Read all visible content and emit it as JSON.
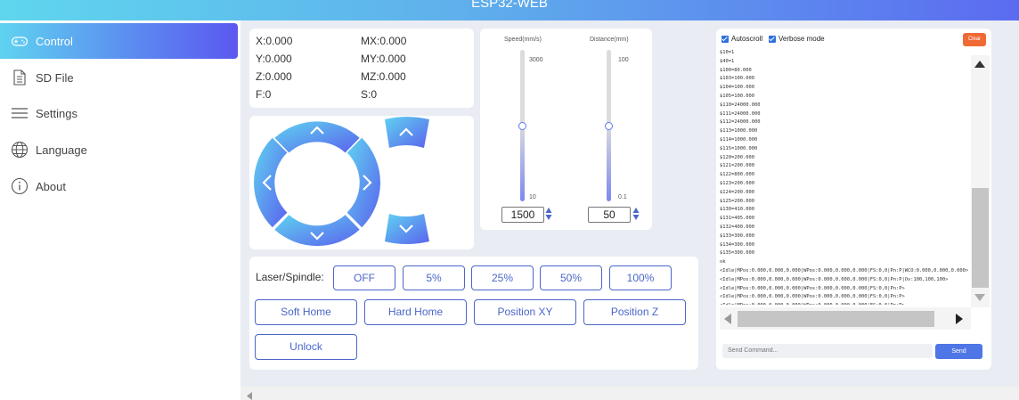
{
  "app": {
    "title": "ESP32-WEB"
  },
  "sidebar": {
    "items": [
      {
        "label": "Control",
        "icon": "gamepad-icon",
        "active": true
      },
      {
        "label": "SD File",
        "icon": "file-icon"
      },
      {
        "label": "Settings",
        "icon": "menu-icon"
      },
      {
        "label": "Language",
        "icon": "globe-icon"
      },
      {
        "label": "About",
        "icon": "info-icon"
      }
    ]
  },
  "coords": {
    "x": "X:0.000",
    "mx": "MX:0.000",
    "y": "Y:0.000",
    "my": "MY:0.000",
    "z": "Z:0.000",
    "mz": "MZ:0.000",
    "f": "F:0",
    "s": "S:0"
  },
  "sliders": {
    "speed": {
      "label": "Speed(mm/s)",
      "max_label": "3000",
      "min_label": "10",
      "value": "1500"
    },
    "distance": {
      "label": "Distance(mm)",
      "max_label": "100",
      "min_label": "0.1",
      "value": "50"
    }
  },
  "laser": {
    "label": "Laser/Spindle:",
    "buttons": [
      "OFF",
      "5%",
      "25%",
      "50%",
      "100%"
    ]
  },
  "actions": {
    "soft_home": "Soft Home",
    "hard_home": "Hard Home",
    "position_xy": "Position XY",
    "position_z": "Position Z",
    "unlock": "Unlock"
  },
  "console": {
    "autoscroll": "Autoscroll",
    "verbose": "Verbose mode",
    "clear": "Clear",
    "placeholder": "Send Command...",
    "send": "Send",
    "lines": [
      "$10=1",
      "$40=1",
      "$100=80.000",
      "$103=100.000",
      "$104=100.000",
      "$105=100.000",
      "$110=24000.000",
      "$111=24000.000",
      "$112=24000.000",
      "$113=1000.000",
      "$114=1000.000",
      "$115=1000.000",
      "$120=200.000",
      "$121=200.000",
      "$122=800.000",
      "$123=200.000",
      "$124=200.000",
      "$125=200.000",
      "$130=410.000",
      "$131=405.000",
      "$132=400.000",
      "$133=300.000",
      "$134=300.000",
      "$135=300.000",
      "ok",
      "<Idle|MPos:0.000,0.000,0.000|WPos:0.000,0.000,0.000|FS:0,0|Pn:P|WCO:0.000,0.000,0.000>",
      "<Idle|MPos:0.000,0.000,0.000|WPos:0.000,0.000,0.000|FS:0,0|Pn:P|Ov:100,100,100>",
      "<Idle|MPos:0.000,0.000,0.000|WPos:0.000,0.000,0.000|FS:0,0|Pn:P>",
      "<Idle|MPos:0.000,0.000,0.000|WPos:0.000,0.000,0.000|FS:0,0|Pn:P>",
      "<Idle|MPos:0.000,0.000,0.000|WPos:0.000,0.000,0.000|FS:0,0|Pn:P>",
      "<Idle|MPos:0.000,0.000,0.000|WPos:0.000,0.000,0.000|FS:0,0|Pn:P>"
    ]
  },
  "colors": {
    "accent": "#4a67c9",
    "clear": "#f06a35",
    "send": "#4f76e6"
  }
}
